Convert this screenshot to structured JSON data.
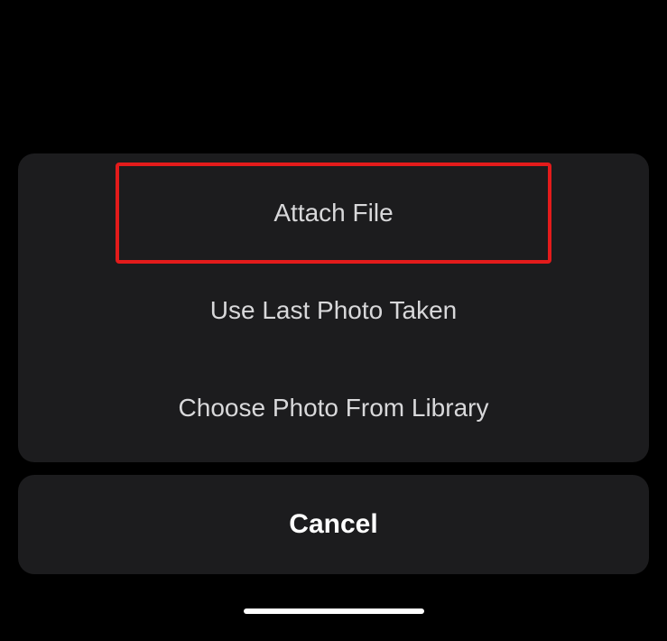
{
  "actionSheet": {
    "options": {
      "attachFile": "Attach File",
      "useLastPhoto": "Use Last Photo Taken",
      "chooseFromLibrary": "Choose Photo From Library"
    },
    "cancel": "Cancel"
  }
}
